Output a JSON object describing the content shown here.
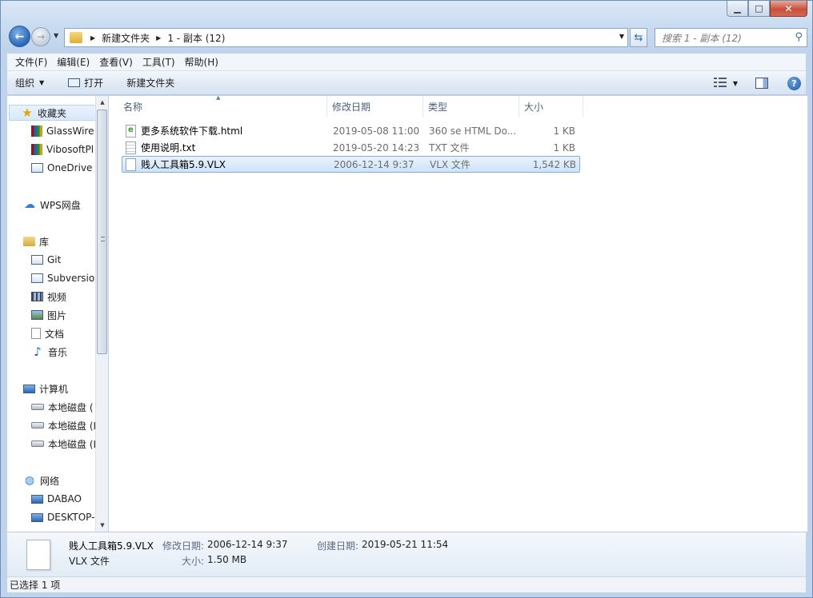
{
  "window": {
    "minimize_glyph": "▁",
    "maximize_glyph": "□",
    "close_glyph": "✕"
  },
  "nav": {
    "back_glyph": "←",
    "forward_glyph": "→",
    "breadcrumb": [
      "新建文件夹",
      "1 - 副本 (12)"
    ],
    "search_placeholder": "搜索 1 - 副本 (12)"
  },
  "menu": [
    "文件(F)",
    "编辑(E)",
    "查看(V)",
    "工具(T)",
    "帮助(H)"
  ],
  "commands": {
    "organize": "组织",
    "open": "打开",
    "new_folder": "新建文件夹"
  },
  "sidebar": {
    "favorites": {
      "label": "收藏夹",
      "items": [
        "GlassWire",
        "VibosoftPl",
        "OneDrive"
      ]
    },
    "wps": "WPS网盘",
    "libraries": {
      "label": "库",
      "items": [
        "Git",
        "Subversio",
        "视频",
        "图片",
        "文档",
        "音乐"
      ]
    },
    "computer": {
      "label": "计算机",
      "items": [
        "本地磁盘 (",
        "本地磁盘 (I",
        "本地磁盘 (I"
      ]
    },
    "network": {
      "label": "网络",
      "items": [
        "DABAO",
        "DESKTOP-"
      ]
    }
  },
  "columns": [
    "名称",
    "修改日期",
    "类型",
    "大小"
  ],
  "files": [
    {
      "name": "更多系统软件下载.html",
      "date": "2019-05-08 11:00",
      "type": "360 se HTML Do...",
      "size": "1 KB",
      "icon": "html"
    },
    {
      "name": "使用说明.txt",
      "date": "2019-05-20 14:23",
      "type": "TXT 文件",
      "size": "1 KB",
      "icon": "txt"
    },
    {
      "name": "贱人工具箱5.9.VLX",
      "date": "2006-12-14 9:37",
      "type": "VLX 文件",
      "size": "1,542 KB",
      "icon": "blank"
    }
  ],
  "details": {
    "filename": "贱人工具箱5.9.VLX",
    "type": "VLX 文件",
    "modified_label": "修改日期:",
    "modified_value": "2006-12-14 9:37",
    "size_label": "大小:",
    "size_value": "1.50 MB",
    "created_label": "创建日期:",
    "created_value": "2019-05-21 11:54"
  },
  "status": "已选择 1 项"
}
